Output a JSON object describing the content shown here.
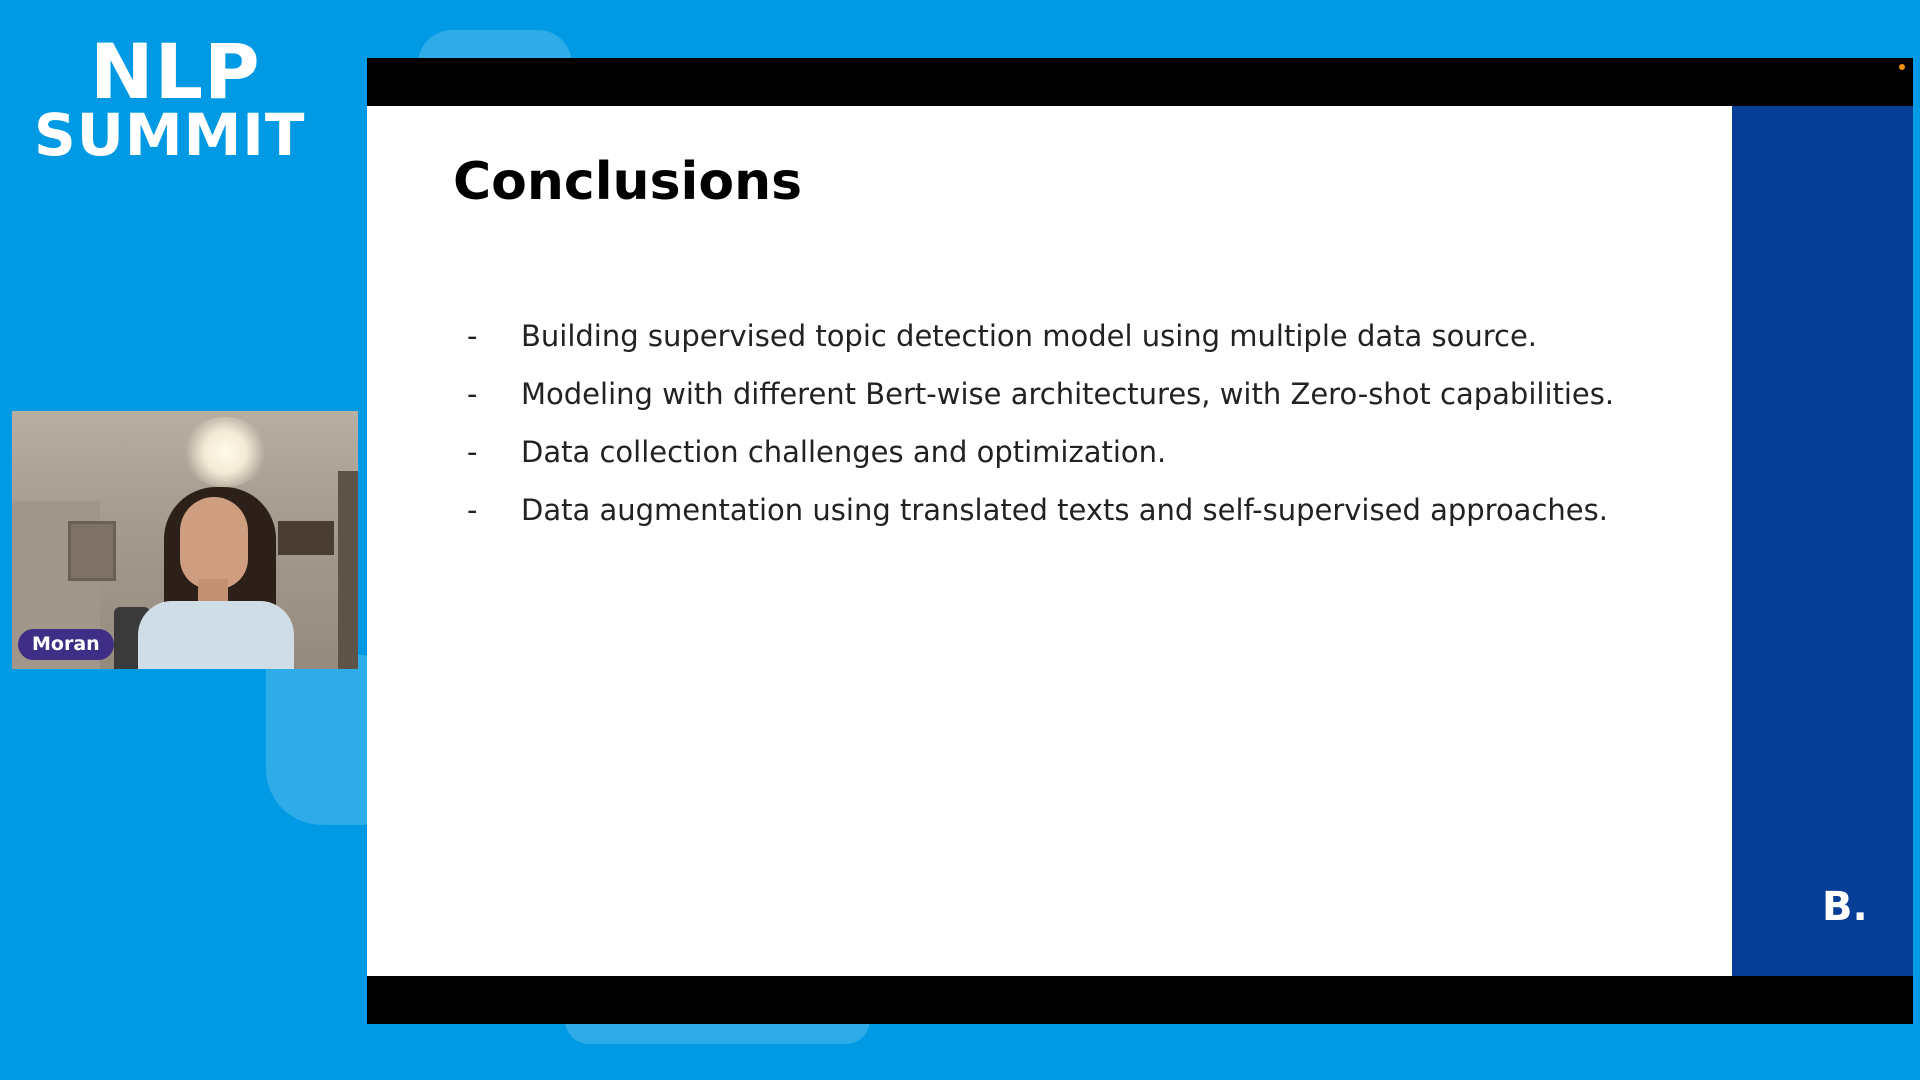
{
  "event_logo": {
    "line1": "NLP",
    "line2": "SUMMIT"
  },
  "speaker": {
    "name": "Moran"
  },
  "slide": {
    "title": "Conclusions",
    "bullet_marker": "-",
    "bullets": [
      "Building supervised topic detection model using multiple data source.",
      "Modeling with different Bert-wise architectures, with Zero-shot capabilities.",
      "Data collection challenges and optimization.",
      "Data augmentation using translated texts and self-supervised approaches."
    ],
    "brand_mark": "B."
  },
  "colors": {
    "background": "#0099e4",
    "slide_band": "#063d96",
    "name_badge": "#3f2e86",
    "recording_dot": "#f39200"
  }
}
